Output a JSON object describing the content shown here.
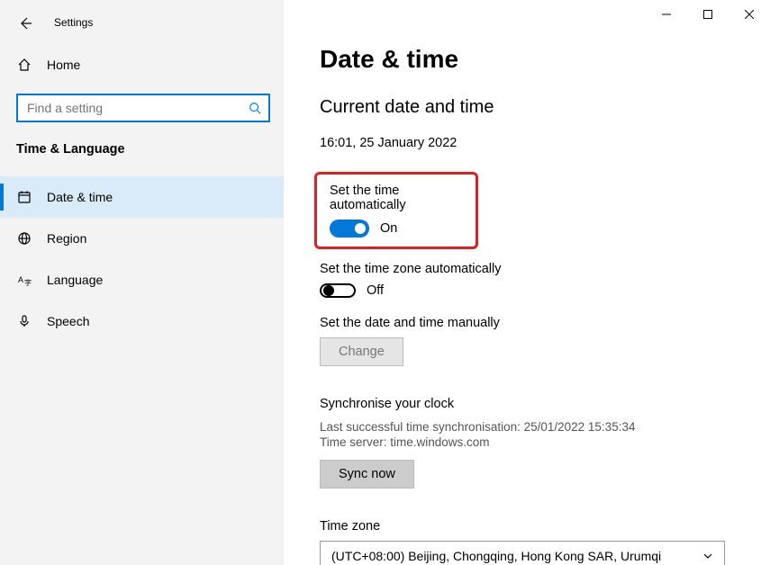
{
  "app": {
    "title": "Settings"
  },
  "window_controls": {
    "minimize": "–",
    "maximize": "□",
    "close": "✕"
  },
  "sidebar": {
    "home_label": "Home",
    "search_placeholder": "Find a setting",
    "section_title": "Time & Language",
    "items": [
      {
        "label": "Date & time"
      },
      {
        "label": "Region"
      },
      {
        "label": "Language"
      },
      {
        "label": "Speech"
      }
    ]
  },
  "main": {
    "heading": "Date & time",
    "subheading": "Current date and time",
    "current_datetime": "16:01, 25 January 2022",
    "set_time_auto": {
      "label": "Set the time automatically",
      "state": "On"
    },
    "set_tz_auto": {
      "label": "Set the time zone automatically",
      "state": "Off"
    },
    "manual": {
      "label": "Set the date and time manually",
      "button": "Change"
    },
    "sync": {
      "heading": "Synchronise your clock",
      "last_sync": "Last successful time synchronisation: 25/01/2022 15:35:34",
      "server": "Time server: time.windows.com",
      "button": "Sync now"
    },
    "timezone": {
      "label": "Time zone",
      "value": "(UTC+08:00) Beijing, Chongqing, Hong Kong SAR, Urumqi"
    }
  }
}
